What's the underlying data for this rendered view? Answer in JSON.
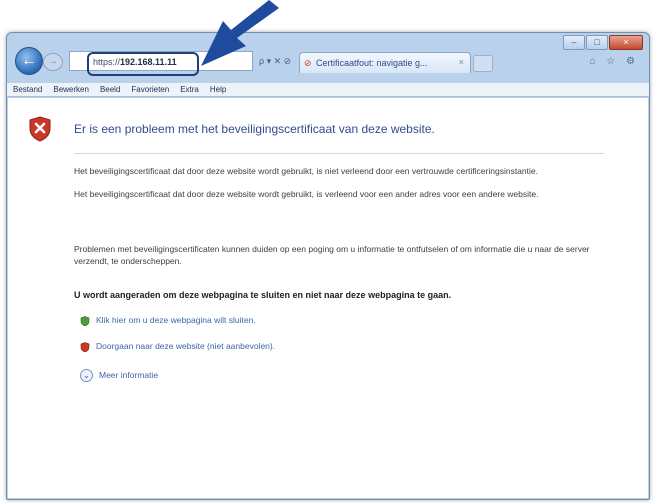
{
  "window": {
    "controls": [
      "–",
      "□",
      "×"
    ]
  },
  "address_bar": {
    "url_prefix": "https://",
    "url_host": "192.168.11.11",
    "actions": "ρ ▾ ✕ ⊘"
  },
  "tab": {
    "title": "Certificaatfout: navigatie g...",
    "close": "×"
  },
  "right_icons": "⌂ ☆ ⚙",
  "menu": [
    "Bestand",
    "Bewerken",
    "Beeld",
    "Favorieten",
    "Extra",
    "Help"
  ],
  "content": {
    "heading": "Er is een probleem met het beveiligingscertificaat van deze website.",
    "paragraph_1": "Het beveiligingscertificaat dat door deze website wordt gebruikt, is niet verleend door een vertrouwde certificeringsinstantie.",
    "paragraph_2": "Het beveiligingscertificaat dat door deze website wordt gebruikt, is verleend voor een ander adres voor een andere website.",
    "paragraph_3": "Problemen met beveiligingscertificaten kunnen duiden op een poging om u informatie te ontfutselen of om informatie die u naar de server verzendt, te onderscheppen.",
    "recommendation": "U wordt aangeraden om deze webpagina te sluiten en niet naar deze webpagina te gaan.",
    "option_close": "Klik hier om u deze webpagina wilt sluiten.",
    "option_continue": "Doorgaan naar deze website (niet aanbevolen).",
    "option_more": "Meer informatie"
  },
  "colors": {
    "link": "#3d66a8",
    "heading": "#2f4d8f",
    "annotation_arrow": "#1f4b9e"
  }
}
